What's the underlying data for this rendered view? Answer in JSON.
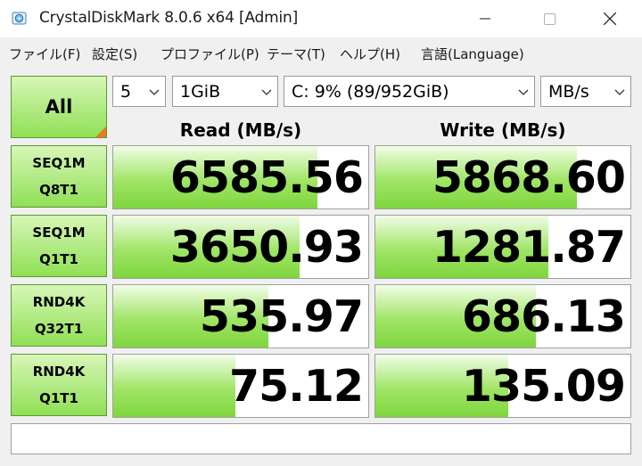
{
  "window": {
    "title": "CrystalDiskMark 8.0.6 x64 [Admin]",
    "app_icon": "crystaldiskmark-icon",
    "controls": [
      "minimize-icon",
      "maximize-icon",
      "close-icon"
    ]
  },
  "menu": {
    "file": "ファイル(F)",
    "settings": "設定(S)",
    "profile": "プロファイル(P)",
    "theme": "テーマ(T)",
    "help": "ヘルプ(H)",
    "language": "言語(Language)"
  },
  "controls": {
    "all_label": "All",
    "count": "5",
    "size": "1GiB",
    "drive": "C: 9% (89/952GiB)",
    "unit": "MB/s"
  },
  "columns": {
    "read": "Read (MB/s)",
    "write": "Write (MB/s)"
  },
  "rows": [
    {
      "line1": "SEQ1M",
      "line2": "Q8T1",
      "read": "6585.56",
      "write": "5868.60",
      "read_fill": 0.8,
      "write_fill": 0.79
    },
    {
      "line1": "SEQ1M",
      "line2": "Q1T1",
      "read": "3650.93",
      "write": "1281.87",
      "read_fill": 0.73,
      "write_fill": 0.68
    },
    {
      "line1": "RND4K",
      "line2": "Q32T1",
      "read": "535.97",
      "write": "686.13",
      "read_fill": 0.61,
      "write_fill": 0.63
    },
    {
      "line1": "RND4K",
      "line2": "Q1T1",
      "read": "75.12",
      "write": "135.09",
      "read_fill": 0.48,
      "write_fill": 0.52
    }
  ],
  "colors": {
    "accent_green": "#8fe055",
    "corner_orange": "#e87a1f"
  },
  "status": ""
}
